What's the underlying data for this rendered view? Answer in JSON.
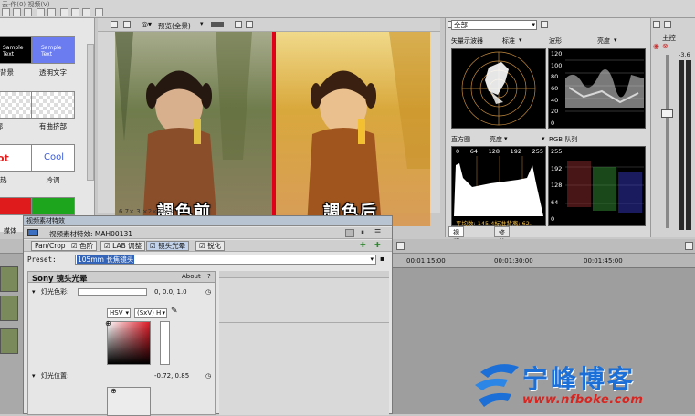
{
  "topbar": {
    "menu_text": "云·作(0)  视频(V)"
  },
  "media": {
    "items": [
      {
        "label": "背景",
        "thumb_text": "Sample Text",
        "bg": "#000000",
        "fg": "#ffffff"
      },
      {
        "label": "透明文字",
        "thumb_text": "Sample Text",
        "bg": "#6b7cf0",
        "fg": "#ffffff"
      },
      {
        "label": "轮廓",
        "thumb_text": "",
        "bg": "#ffffff",
        "fg": "#000000"
      },
      {
        "label": "有曲挤部",
        "thumb_text": "",
        "bg": "#ffffff",
        "fg": "#000000"
      },
      {
        "label": "热",
        "thumb_text": "ot",
        "bg": "#ffffff",
        "fg": "#e02020"
      },
      {
        "label": "冷调",
        "thumb_text": "Cool",
        "bg": "#ffffff",
        "fg": "#3a5bd8"
      }
    ]
  },
  "preview": {
    "dropdown": "预览(全景)",
    "caption_left": "調色前",
    "caption_right": "調色后",
    "status": "6  7×  3 ×2×3  ×3"
  },
  "scopes": {
    "mode_select": "全部",
    "vectorscope_label": "矢量示波器",
    "vectorscope_option": "标准",
    "waveform_label": "波形",
    "waveform_option": "亮度",
    "histogram_label": "直方图",
    "histogram_option": "亮度",
    "parade_label": "RGB 队列",
    "histogram_ticks": [
      "0",
      "64",
      "128",
      "192",
      "255"
    ],
    "waveform_ticks": [
      "120",
      "100",
      "80",
      "60",
      "40",
      "20",
      "0"
    ],
    "parade_ticks": [
      "255",
      "192",
      "128",
      "64",
      "0"
    ],
    "histogram_footer": "平均数: 145.4标准背离: 62.",
    "tab_video_scope": "视频示波器",
    "tab_clip": "修剪器"
  },
  "meters": {
    "label": "主控",
    "value": "-3.6"
  },
  "timeline": {
    "media_tab": "媒体",
    "timecodes": [
      "00:01:15:00",
      "00:01:30:00",
      "00:01:45:00"
    ]
  },
  "fx": {
    "title": "视频素材特效",
    "header": "视频素材特效: MAH00131",
    "chain": [
      "Pan/Crop",
      "色阶",
      "LAB 调整",
      "镜头光晕",
      "锐化"
    ],
    "preset_label": "Preset:",
    "preset_value": "105mm 长焦镜头",
    "plugin_title": "Sony 镜头光晕",
    "about": "About",
    "help": "?",
    "light_color_label": "灯光色彩:",
    "light_color_value": "0, 0.0, 1.0",
    "color_mode": "HSV",
    "color_axis": "(SxV) H",
    "light_position_label": "灯光位置:",
    "light_position_value": "-0.72, 0.85"
  },
  "watermark": {
    "text": "宁峰博客",
    "url": "www.nfboke.com"
  }
}
